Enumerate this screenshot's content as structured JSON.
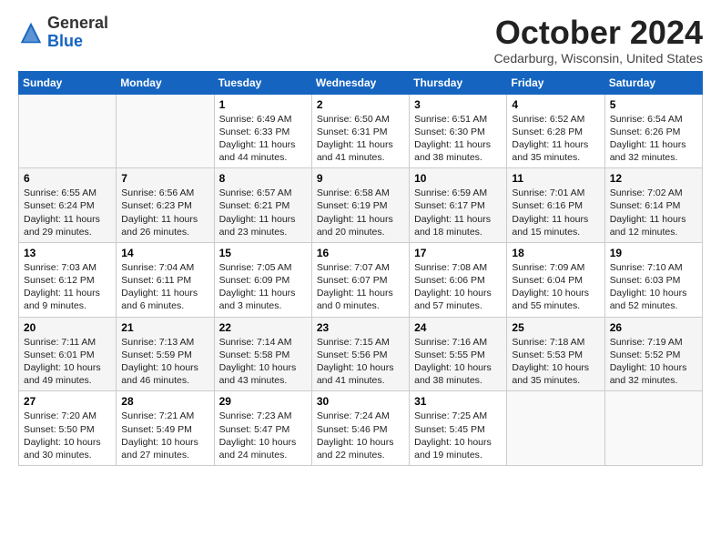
{
  "header": {
    "logo_general": "General",
    "logo_blue": "Blue",
    "month_title": "October 2024",
    "location": "Cedarburg, Wisconsin, United States"
  },
  "weekdays": [
    "Sunday",
    "Monday",
    "Tuesday",
    "Wednesday",
    "Thursday",
    "Friday",
    "Saturday"
  ],
  "weeks": [
    [
      {
        "day": "",
        "info": ""
      },
      {
        "day": "",
        "info": ""
      },
      {
        "day": "1",
        "info": "Sunrise: 6:49 AM\nSunset: 6:33 PM\nDaylight: 11 hours and 44 minutes."
      },
      {
        "day": "2",
        "info": "Sunrise: 6:50 AM\nSunset: 6:31 PM\nDaylight: 11 hours and 41 minutes."
      },
      {
        "day": "3",
        "info": "Sunrise: 6:51 AM\nSunset: 6:30 PM\nDaylight: 11 hours and 38 minutes."
      },
      {
        "day": "4",
        "info": "Sunrise: 6:52 AM\nSunset: 6:28 PM\nDaylight: 11 hours and 35 minutes."
      },
      {
        "day": "5",
        "info": "Sunrise: 6:54 AM\nSunset: 6:26 PM\nDaylight: 11 hours and 32 minutes."
      }
    ],
    [
      {
        "day": "6",
        "info": "Sunrise: 6:55 AM\nSunset: 6:24 PM\nDaylight: 11 hours and 29 minutes."
      },
      {
        "day": "7",
        "info": "Sunrise: 6:56 AM\nSunset: 6:23 PM\nDaylight: 11 hours and 26 minutes."
      },
      {
        "day": "8",
        "info": "Sunrise: 6:57 AM\nSunset: 6:21 PM\nDaylight: 11 hours and 23 minutes."
      },
      {
        "day": "9",
        "info": "Sunrise: 6:58 AM\nSunset: 6:19 PM\nDaylight: 11 hours and 20 minutes."
      },
      {
        "day": "10",
        "info": "Sunrise: 6:59 AM\nSunset: 6:17 PM\nDaylight: 11 hours and 18 minutes."
      },
      {
        "day": "11",
        "info": "Sunrise: 7:01 AM\nSunset: 6:16 PM\nDaylight: 11 hours and 15 minutes."
      },
      {
        "day": "12",
        "info": "Sunrise: 7:02 AM\nSunset: 6:14 PM\nDaylight: 11 hours and 12 minutes."
      }
    ],
    [
      {
        "day": "13",
        "info": "Sunrise: 7:03 AM\nSunset: 6:12 PM\nDaylight: 11 hours and 9 minutes."
      },
      {
        "day": "14",
        "info": "Sunrise: 7:04 AM\nSunset: 6:11 PM\nDaylight: 11 hours and 6 minutes."
      },
      {
        "day": "15",
        "info": "Sunrise: 7:05 AM\nSunset: 6:09 PM\nDaylight: 11 hours and 3 minutes."
      },
      {
        "day": "16",
        "info": "Sunrise: 7:07 AM\nSunset: 6:07 PM\nDaylight: 11 hours and 0 minutes."
      },
      {
        "day": "17",
        "info": "Sunrise: 7:08 AM\nSunset: 6:06 PM\nDaylight: 10 hours and 57 minutes."
      },
      {
        "day": "18",
        "info": "Sunrise: 7:09 AM\nSunset: 6:04 PM\nDaylight: 10 hours and 55 minutes."
      },
      {
        "day": "19",
        "info": "Sunrise: 7:10 AM\nSunset: 6:03 PM\nDaylight: 10 hours and 52 minutes."
      }
    ],
    [
      {
        "day": "20",
        "info": "Sunrise: 7:11 AM\nSunset: 6:01 PM\nDaylight: 10 hours and 49 minutes."
      },
      {
        "day": "21",
        "info": "Sunrise: 7:13 AM\nSunset: 5:59 PM\nDaylight: 10 hours and 46 minutes."
      },
      {
        "day": "22",
        "info": "Sunrise: 7:14 AM\nSunset: 5:58 PM\nDaylight: 10 hours and 43 minutes."
      },
      {
        "day": "23",
        "info": "Sunrise: 7:15 AM\nSunset: 5:56 PM\nDaylight: 10 hours and 41 minutes."
      },
      {
        "day": "24",
        "info": "Sunrise: 7:16 AM\nSunset: 5:55 PM\nDaylight: 10 hours and 38 minutes."
      },
      {
        "day": "25",
        "info": "Sunrise: 7:18 AM\nSunset: 5:53 PM\nDaylight: 10 hours and 35 minutes."
      },
      {
        "day": "26",
        "info": "Sunrise: 7:19 AM\nSunset: 5:52 PM\nDaylight: 10 hours and 32 minutes."
      }
    ],
    [
      {
        "day": "27",
        "info": "Sunrise: 7:20 AM\nSunset: 5:50 PM\nDaylight: 10 hours and 30 minutes."
      },
      {
        "day": "28",
        "info": "Sunrise: 7:21 AM\nSunset: 5:49 PM\nDaylight: 10 hours and 27 minutes."
      },
      {
        "day": "29",
        "info": "Sunrise: 7:23 AM\nSunset: 5:47 PM\nDaylight: 10 hours and 24 minutes."
      },
      {
        "day": "30",
        "info": "Sunrise: 7:24 AM\nSunset: 5:46 PM\nDaylight: 10 hours and 22 minutes."
      },
      {
        "day": "31",
        "info": "Sunrise: 7:25 AM\nSunset: 5:45 PM\nDaylight: 10 hours and 19 minutes."
      },
      {
        "day": "",
        "info": ""
      },
      {
        "day": "",
        "info": ""
      }
    ]
  ]
}
